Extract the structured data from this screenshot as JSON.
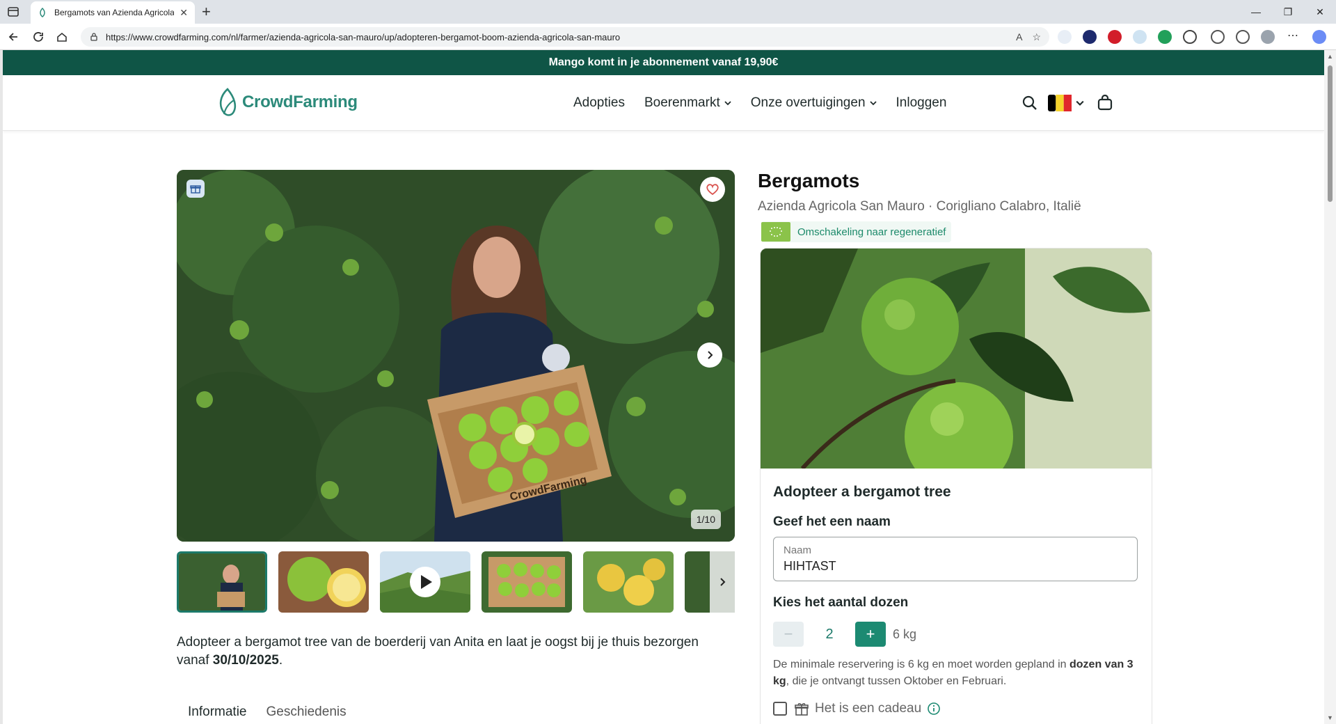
{
  "browser": {
    "tab_title": "Bergamots van Azienda Agricola S",
    "url": "https://www.crowdfarming.com/nl/farmer/azienda-agricola-san-mauro/up/adopteren-bergamot-boom-azienda-agricola-san-mauro"
  },
  "promo": "Mango komt in je abonnement vanaf 19,90€",
  "logo": "CrowdFarming",
  "nav": {
    "adopties": "Adopties",
    "boerenmarkt": "Boerenmarkt",
    "overtuigingen": "Onze overtuigingen",
    "inloggen": "Inloggen"
  },
  "gallery": {
    "counter": "1/10",
    "crate_text": "CrowdFarming"
  },
  "intro": {
    "text": "Adopteer a bergamot tree van de boerderij van Anita en laat je oogst bij je thuis bezorgen vanaf ",
    "date": "30/10/2025",
    "end": "."
  },
  "tabs": [
    "Informatie",
    "Geschiedenis"
  ],
  "product": {
    "title": "Bergamots",
    "subtitle": "Azienda Agricola San Mauro · Corigliano Calabro, Italië",
    "badge": "Omschakeling naar regeneratief"
  },
  "card": {
    "heading": "Adopteer a bergamot tree",
    "name_label": "Geef het een naam",
    "name_placeholder": "Naam",
    "name_value": "HIHTAST",
    "qty_label": "Kies het aantal dozen",
    "qty_minus": "−",
    "qty_value": "2",
    "qty_plus": "+",
    "qty_unit": "6 kg",
    "note_1": "De minimale reservering is 6 kg en moet worden gepland in ",
    "note_bold": "dozen van 3 kg",
    "note_2": ", die je ontvangt tussen Oktober en Februari.",
    "gift_label": "Het is een cadeau"
  },
  "colors": {
    "brand_dark": "#0f5546",
    "brand": "#1c8a72",
    "flag": [
      "#000000",
      "#f6d32c",
      "#e0262c"
    ]
  }
}
